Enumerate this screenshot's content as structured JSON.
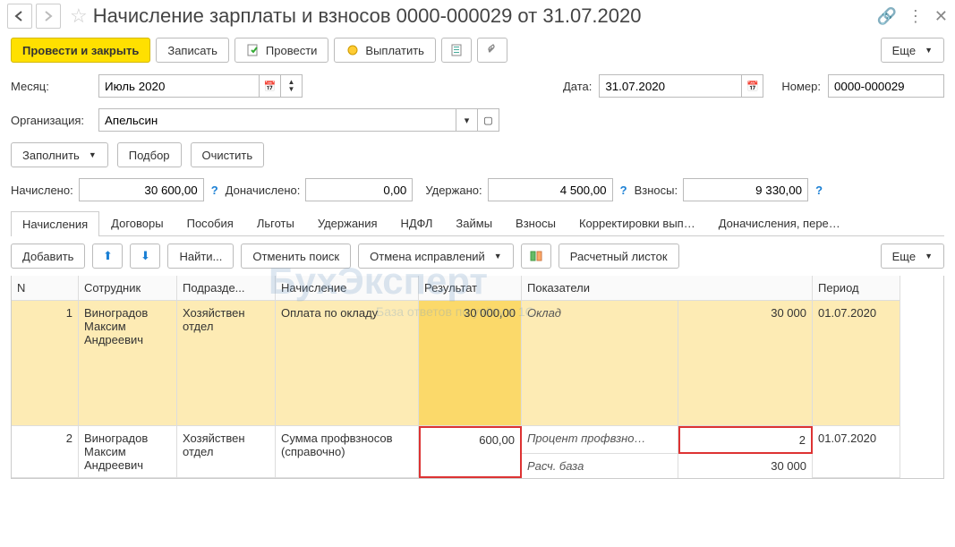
{
  "title": "Начисление зарплаты и взносов 0000-000029 от 31.07.2020",
  "toolbar": {
    "post_close": "Провести и закрыть",
    "save": "Записать",
    "post": "Провести",
    "pay": "Выплатить",
    "more": "Еще"
  },
  "fields": {
    "month_label": "Месяц:",
    "month_value": "Июль 2020",
    "date_label": "Дата:",
    "date_value": "31.07.2020",
    "number_label": "Номер:",
    "number_value": "0000-000029",
    "org_label": "Организация:",
    "org_value": "Апельсин"
  },
  "actions": {
    "fill": "Заполнить",
    "pick": "Подбор",
    "clear": "Очистить"
  },
  "totals": {
    "accrued_label": "Начислено:",
    "accrued": "30 600,00",
    "extra_label": "Доначислено:",
    "extra": "0,00",
    "withheld_label": "Удержано:",
    "withheld": "4 500,00",
    "contrib_label": "Взносы:",
    "contrib": "9 330,00"
  },
  "tabs": [
    "Начисления",
    "Договоры",
    "Пособия",
    "Льготы",
    "Удержания",
    "НДФЛ",
    "Займы",
    "Взносы",
    "Корректировки вып…",
    "Доначисления, пере…"
  ],
  "subtool": {
    "add": "Добавить",
    "find": "Найти...",
    "cancel_search": "Отменить поиск",
    "cancel_fix": "Отмена исправлений",
    "payslip": "Расчетный листок",
    "more": "Еще"
  },
  "headers": {
    "n": "N",
    "emp": "Сотрудник",
    "dept": "Подразде...",
    "accr": "Начисление",
    "result": "Результат",
    "ind": "Показатели",
    "period": "Период"
  },
  "rows": [
    {
      "n": "1",
      "emp": "Виноградов Максим Андреевич",
      "dept": "Хозяйствен отдел",
      "accr": "Оплата по окладу",
      "result": "30 000,00",
      "ind_name": "Оклад",
      "ind_val": "30 000",
      "period": "01.07.2020"
    },
    {
      "n": "2",
      "emp": "Виноградов Максим Андреевич",
      "dept": "Хозяйствен отдел",
      "accr": "Сумма профвзносов (справочно)",
      "result": "600,00",
      "ind_name": "Процент профвзно…",
      "ind_val": "2",
      "ind2_name": "Расч. база",
      "ind2_val": "30 000",
      "period": "01.07.2020"
    }
  ],
  "watermark": "БухЭксперт",
  "watermark_sub": "База ответов по учёту в 1С"
}
